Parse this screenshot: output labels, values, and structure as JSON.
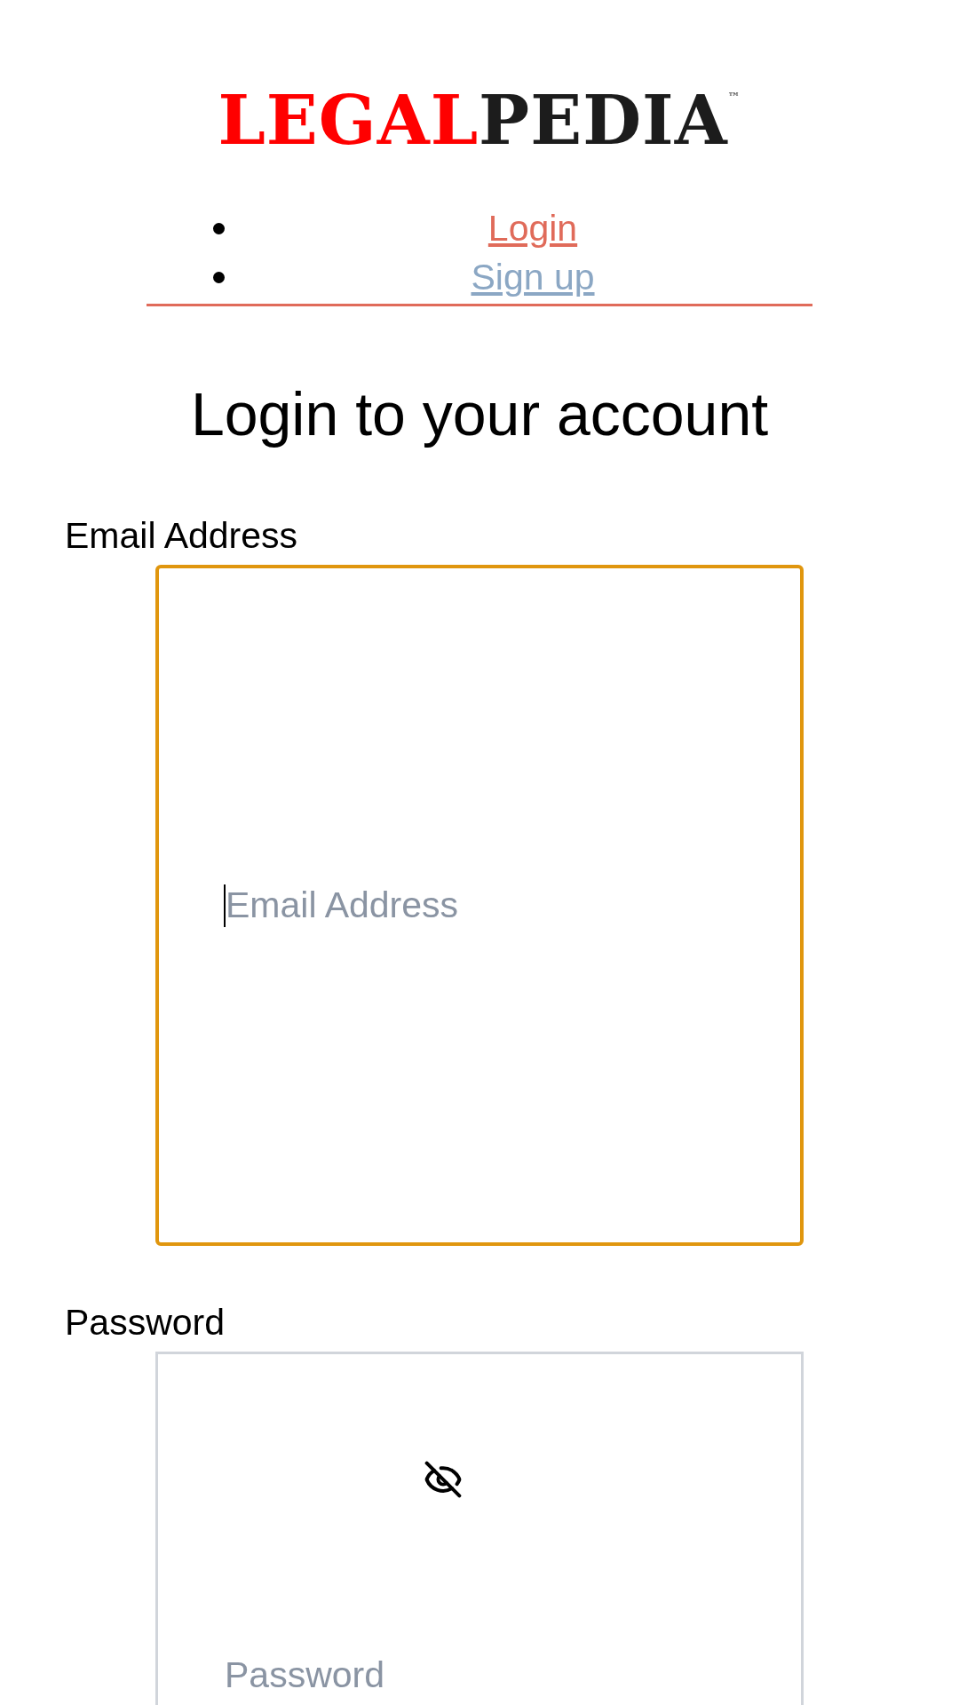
{
  "logo": {
    "first": "LEGAL",
    "second": "PEDIA",
    "mark": "™"
  },
  "nav": [
    {
      "label": "Login",
      "selected": true
    },
    {
      "label": "Sign up",
      "selected": false
    }
  ],
  "heading": "Login to your account",
  "fields": [
    {
      "label": "Email Address",
      "placeholder": "Email Address",
      "focused": true,
      "kind": "email"
    },
    {
      "label": "Password",
      "placeholder": "Password",
      "focused": false,
      "kind": "password",
      "password_visible": false
    }
  ]
}
